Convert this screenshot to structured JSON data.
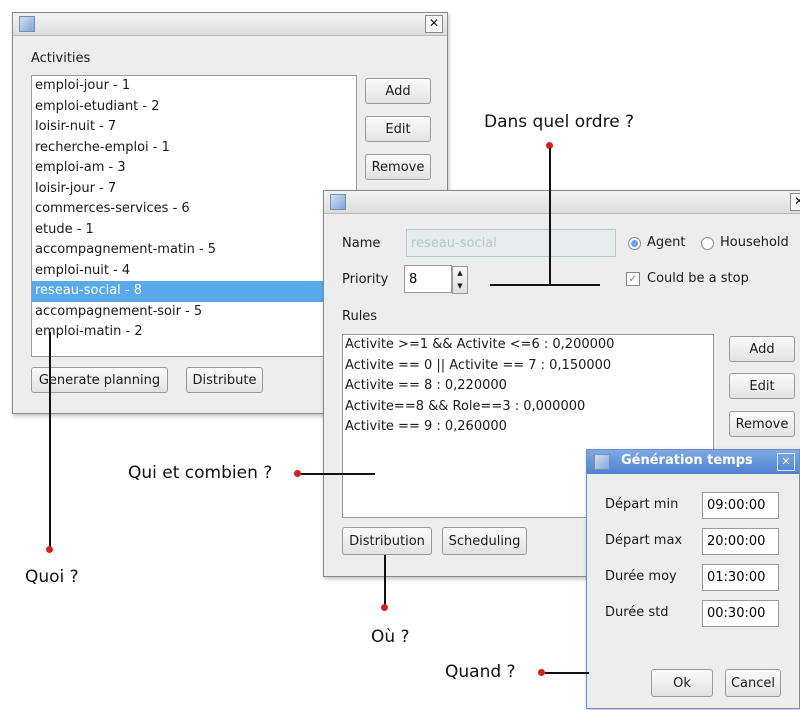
{
  "activities_window": {
    "close_glyph": "✕",
    "title_label": "Activities",
    "items": [
      "emploi-jour - 1",
      "emploi-etudiant - 2",
      "loisir-nuit - 7",
      "recherche-emploi - 1",
      "emploi-am - 3",
      "loisir-jour - 7",
      "commerces-services - 6",
      "etude - 1",
      "accompagnement-matin - 5",
      "emploi-nuit - 4",
      "reseau-social - 8",
      "accompagnement-soir - 5",
      "emploi-matin - 2"
    ],
    "selected_item": "reseau-social - 8",
    "buttons": {
      "add": "Add",
      "edit": "Edit",
      "remove": "Remove"
    },
    "generate_planning": "Generate planning",
    "distribute": "Distribute"
  },
  "activity_editor": {
    "name_label": "Name",
    "name_value": "reseau-social",
    "type_options": {
      "agent": "Agent",
      "household": "Household"
    },
    "selected_type": "Agent",
    "priority_label": "Priority",
    "priority_value": "8",
    "could_be_stop_label": "Could be a stop",
    "could_be_stop_checked": true,
    "rules_label": "Rules",
    "rules": [
      "Activite >=1 && Activite <=6  : 0,200000",
      "Activite == 0 || Activite == 7 : 0,150000",
      "Activite == 8 : 0,220000",
      "Activite==8 && Role==3 : 0,000000",
      "Activite == 9 : 0,260000"
    ],
    "buttons": {
      "add": "Add",
      "edit": "Edit",
      "remove": "Remove"
    },
    "distribution": "Distribution",
    "scheduling": "Scheduling"
  },
  "generation_dialog": {
    "title": "Génération temps",
    "close_glyph": "✕",
    "fields": [
      {
        "label": "Départ min",
        "value": "09:00:00"
      },
      {
        "label": "Départ max",
        "value": "20:00:00"
      },
      {
        "label": "Durée moy",
        "value": "01:30:00"
      },
      {
        "label": "Durée std",
        "value": "00:30:00"
      }
    ],
    "ok": "Ok",
    "cancel": "Cancel",
    "title_color": "#5b8fd6"
  },
  "annotations": {
    "order": "Dans quel ordre ?",
    "who": "Qui et combien ?",
    "what": "Quoi ?",
    "where": "Où ?",
    "when": "Quand ?",
    "marker_color": "#d42020"
  }
}
